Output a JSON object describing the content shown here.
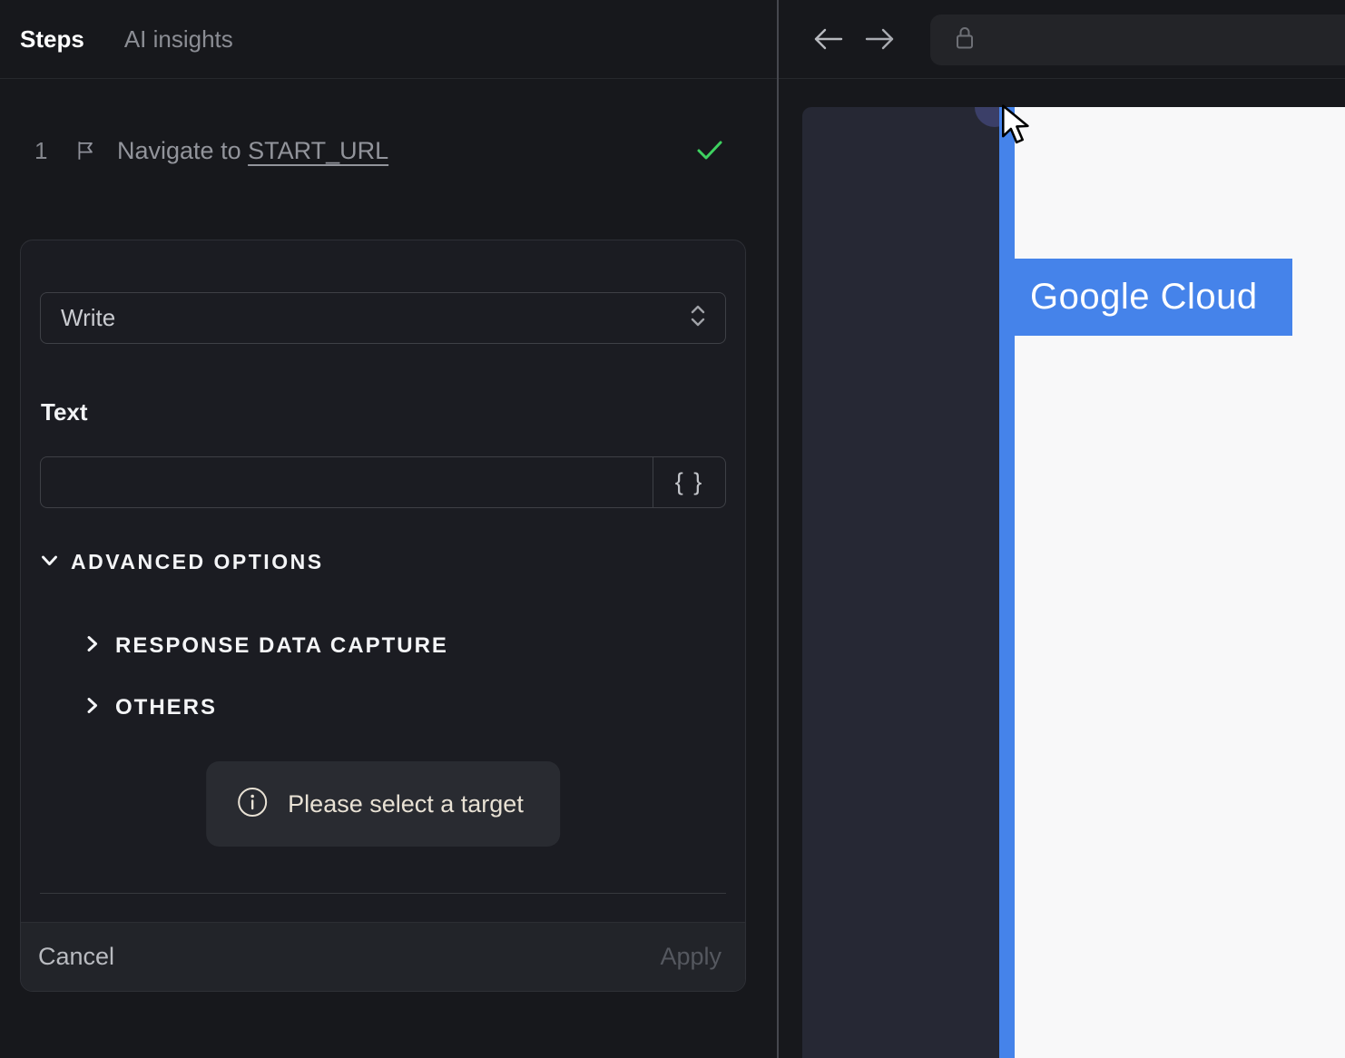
{
  "left_panel": {
    "tabs": [
      {
        "label": "Steps",
        "active": true
      },
      {
        "label": "AI insights",
        "active": false
      }
    ],
    "step": {
      "number": "1",
      "icon": "flag-icon",
      "text": "Navigate to ",
      "link": "START_URL",
      "status": "success"
    },
    "editor": {
      "action_select": {
        "value": "Write"
      },
      "text_field": {
        "label": "Text",
        "value": "",
        "placeholder": ""
      },
      "variable_button_label": "{ }",
      "advanced_options_label": "ADVANCED OPTIONS",
      "sections": [
        {
          "label": "RESPONSE DATA CAPTURE"
        },
        {
          "label": "OTHERS"
        }
      ],
      "toast": {
        "text": "Please select a target"
      },
      "footer": {
        "cancel_label": "Cancel",
        "apply_label": "Apply"
      }
    }
  },
  "browser": {
    "toolbar": {
      "back_icon": "arrow-left",
      "forward_icon": "arrow-right",
      "lock_icon": "padlock",
      "address_value": ""
    },
    "page": {
      "brand_text": "Google Cloud"
    }
  },
  "colors": {
    "accent_blue": "#4583ea",
    "success_green": "#3ed160",
    "toast_text": "#e8e1d4",
    "panel_navy": "#262834",
    "page_white": "#f8f8f9",
    "background": "#17181c"
  }
}
